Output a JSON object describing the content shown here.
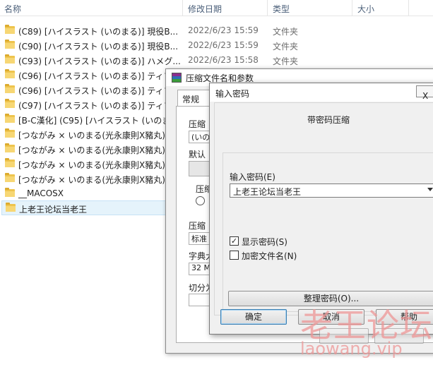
{
  "explorer": {
    "columns": {
      "name": "名称",
      "modified": "修改日期",
      "type": "类型",
      "size": "大小"
    },
    "rows": [
      {
        "name": "(C89) [ハイスラスト (いのまる)] 現役B...",
        "date": "2022/6/23 15:59",
        "type": "文件夹"
      },
      {
        "name": "(C90) [ハイスラスト (いのまる)] 現役B...",
        "date": "2022/6/23 15:59",
        "type": "文件夹"
      },
      {
        "name": "(C93) [ハイスラスト (いのまる)] ハメグ...",
        "date": "2022/6/23 15:58",
        "type": "文件夹"
      },
      {
        "name": "(C96) [ハイスラスト (いのまる)] ティフ",
        "date": "",
        "type": ""
      },
      {
        "name": "(C96) [ハイスラスト (いのまる)] ティフ",
        "date": "",
        "type": ""
      },
      {
        "name": "(C97) [ハイスラスト (いのまる)] ティフ",
        "date": "",
        "type": ""
      },
      {
        "name": "[B-C漢化] (C95) [ハイスラスト (いのま",
        "date": "",
        "type": ""
      },
      {
        "name": "[つながみ × いのまる(光永康則X豬丸)]",
        "date": "",
        "type": ""
      },
      {
        "name": "[つながみ × いのまる(光永康則X豬丸)]",
        "date": "",
        "type": ""
      },
      {
        "name": "[つながみ × いのまる(光永康則X豬丸)]",
        "date": "",
        "type": ""
      },
      {
        "name": "[つながみ × いのまる(光永康則X豬丸)]",
        "date": "",
        "type": ""
      },
      {
        "name": "__MACOSX",
        "date": "",
        "type": ""
      },
      {
        "name": "上老王论坛当老王",
        "date": "",
        "type": ""
      }
    ]
  },
  "rar_dialog": {
    "title": "压缩文件名和参数",
    "tab_general": "常规",
    "partial_labels": [
      "压缩",
      "(いの",
      "默认",
      "压缩",
      "压缩",
      "标准",
      "字典大",
      "32 M",
      "切分为"
    ],
    "icon_colors": [
      "#8b2c8f",
      "#2f6fb5",
      "#3a9c3a"
    ]
  },
  "password_dialog": {
    "title": "输入密码",
    "close_label": "X",
    "subtitle": "带密码压缩",
    "password_label": "输入密码(E)",
    "password_value": "上老王论坛当老王",
    "show_password_label": "显示密码(S)",
    "show_password_checked": true,
    "show_password_mark": "✓",
    "encrypt_names_label": "加密文件名(N)",
    "encrypt_names_checked": false,
    "organize_button": "整理密码(O)...",
    "ok_button": "确定",
    "cancel_button": "取消",
    "help_button": "帮助"
  },
  "watermark": {
    "line1": "老王论坛",
    "line2": "laowang.vip"
  }
}
